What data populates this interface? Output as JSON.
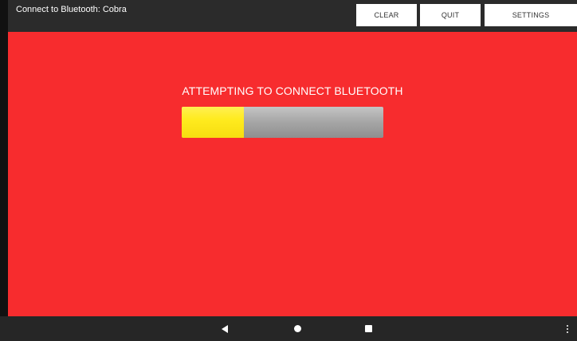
{
  "app": {
    "title": "Connect to Bluetooth: Cobra"
  },
  "toolbar": {
    "clear_label": "CLEAR",
    "quit_label": "QUIT",
    "settings_label": "SETTINGS"
  },
  "main": {
    "status": "ATTEMPTING TO CONNECT BLUETOOTH",
    "progress": 0.31,
    "background_color": "#f72c2e",
    "progress_fill_color": "#ffeb1f",
    "progress_track_color": "#a8a8a8"
  },
  "navbar": {
    "icons": [
      "back-icon",
      "home-icon",
      "recents-icon",
      "overflow-menu-icon"
    ]
  }
}
